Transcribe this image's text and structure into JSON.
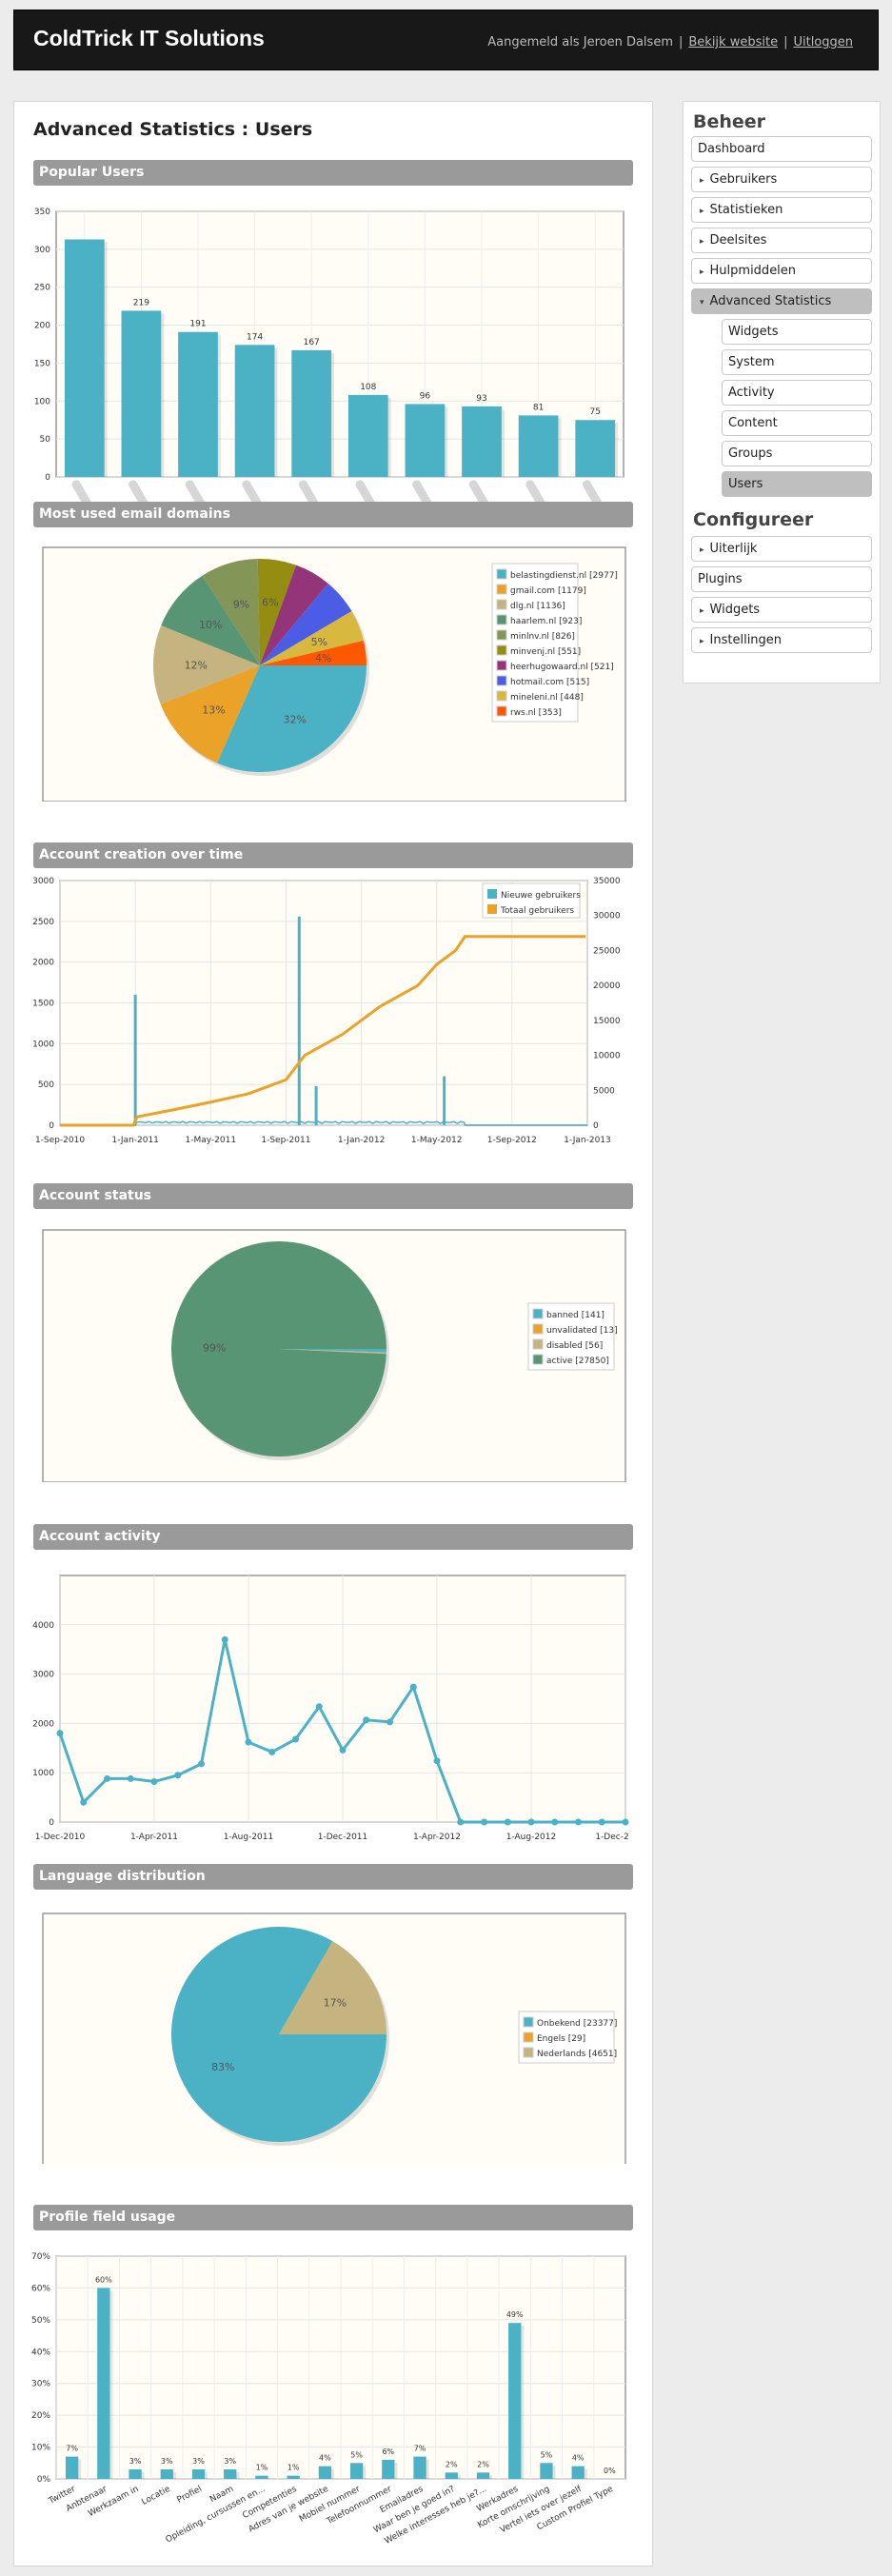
{
  "header": {
    "title": "ColdTrick IT Solutions",
    "logged_in": "Aangemeld als Jeroen Dalsem",
    "sep": "|",
    "view_site": "Bekijk website",
    "logout": "Uitloggen"
  },
  "page": {
    "title": "Advanced Statistics : Users"
  },
  "sections": {
    "popular": "Popular Users",
    "domains": "Most used email domains",
    "creation": "Account creation over time",
    "status": "Account status",
    "activity": "Account activity",
    "language": "Language distribution",
    "profile": "Profile field usage"
  },
  "sidebar": {
    "beheer": "Beheer",
    "configureer": "Configureer",
    "items": [
      {
        "label": "Dashboard",
        "arrow": ""
      },
      {
        "label": "Gebruikers",
        "arrow": "▸"
      },
      {
        "label": "Statistieken",
        "arrow": "▸"
      },
      {
        "label": "Deelsites",
        "arrow": "▸"
      },
      {
        "label": "Hulpmiddelen",
        "arrow": "▸"
      },
      {
        "label": "Advanced Statistics",
        "arrow": "▾"
      }
    ],
    "subitems": [
      "Widgets",
      "System",
      "Activity",
      "Content",
      "Groups",
      "Users"
    ],
    "config_items": [
      {
        "label": "Uiterlijk",
        "arrow": "▸"
      },
      {
        "label": "Plugins",
        "arrow": ""
      },
      {
        "label": "Widgets",
        "arrow": "▸"
      },
      {
        "label": "Instellingen",
        "arrow": "▸"
      }
    ]
  },
  "chart_data": [
    {
      "type": "bar",
      "title": "Popular Users",
      "values": [
        313,
        219,
        191,
        174,
        167,
        108,
        96,
        93,
        81,
        75
      ],
      "labels": [
        "219",
        "191",
        "174",
        "167",
        "108",
        "96",
        "93",
        "81",
        "75"
      ],
      "ylim": [
        0,
        350
      ],
      "yticks": [
        "0",
        "50",
        "100",
        "150",
        "200",
        "250",
        "300",
        "350"
      ],
      "color": "#4bb2c5"
    },
    {
      "type": "pie",
      "title": "Most used email domains",
      "slices": [
        {
          "name": "belastingdienst.nl [2977]",
          "value": 2977,
          "color": "#4bb2c5",
          "label": "32%"
        },
        {
          "name": "gmail.com [1179]",
          "value": 1179,
          "color": "#eaa228",
          "label": "13%"
        },
        {
          "name": "dlg.nl [1136]",
          "value": 1136,
          "color": "#c5b47f",
          "label": "12%"
        },
        {
          "name": "haarlem.nl [923]",
          "value": 923,
          "color": "#579575",
          "label": "10%"
        },
        {
          "name": "minlnv.nl [826]",
          "value": 826,
          "color": "#839557",
          "label": "9%"
        },
        {
          "name": "minvenj.nl [551]",
          "value": 551,
          "color": "#958c12",
          "label": "6%"
        },
        {
          "name": "heerhugowaard.nl [521]",
          "value": 521,
          "color": "#953579",
          "label": ""
        },
        {
          "name": "hotmail.com [515]",
          "value": 515,
          "color": "#4b5de4",
          "label": ""
        },
        {
          "name": "mineleni.nl [448]",
          "value": 448,
          "color": "#d8b83f",
          "label": "5%"
        },
        {
          "name": "rws.nl [353]",
          "value": 353,
          "color": "#ff5800",
          "label": "4%"
        }
      ]
    },
    {
      "type": "line",
      "title": "Account creation over time",
      "x_ticks": [
        "1-Sep-2010",
        "1-Jan-2011",
        "1-May-2011",
        "1-Sep-2011",
        "1-Jan-2012",
        "1-May-2012",
        "1-Sep-2012",
        "1-Jan-2013"
      ],
      "y_ticks": [
        "0",
        "500",
        "1000",
        "1500",
        "2000",
        "2500",
        "3000"
      ],
      "y2_ticks": [
        "0",
        "5000",
        "10000",
        "15000",
        "20000",
        "25000",
        "30000",
        "35000"
      ],
      "series": [
        {
          "name": "Nieuwe gebruikers",
          "color": "#4bb2c5"
        },
        {
          "name": "Totaal gebruikers",
          "color": "#eaa228"
        }
      ],
      "spikes": [
        {
          "month": 4.0,
          "value": 1600
        },
        {
          "month": 12.7,
          "value": 2560
        },
        {
          "month": 13.6,
          "value": 480
        },
        {
          "month": 20.4,
          "value": 600
        }
      ],
      "total": [
        [
          0,
          0
        ],
        [
          3.9,
          0
        ],
        [
          4.1,
          1200
        ],
        [
          6,
          2200
        ],
        [
          8,
          3300
        ],
        [
          10,
          4500
        ],
        [
          12,
          6500
        ],
        [
          13,
          10000
        ],
        [
          15,
          13000
        ],
        [
          17,
          17000
        ],
        [
          19,
          20000
        ],
        [
          20,
          23000
        ],
        [
          21,
          25000
        ],
        [
          21.5,
          27000
        ],
        [
          27.9,
          27000
        ]
      ]
    },
    {
      "type": "pie",
      "title": "Account status",
      "slices": [
        {
          "name": "banned [141]",
          "value": 141,
          "color": "#4bb2c5",
          "label": ""
        },
        {
          "name": "unvalidated [13]",
          "value": 13,
          "color": "#eaa228",
          "label": ""
        },
        {
          "name": "disabled [56]",
          "value": 56,
          "color": "#c5b47f",
          "label": ""
        },
        {
          "name": "active [27850]",
          "value": 27850,
          "color": "#579575",
          "label": "99%"
        }
      ]
    },
    {
      "type": "line",
      "title": "Account activity",
      "x_ticks": [
        "1-Dec-2010",
        "1-Apr-2011",
        "1-Aug-2011",
        "1-Dec-2011",
        "1-Apr-2012",
        "1-Aug-2012",
        "1-Dec-2"
      ],
      "y_ticks": [
        "0",
        "1000",
        "2000",
        "3000",
        "4000"
      ],
      "values": [
        1800,
        400,
        880,
        880,
        820,
        950,
        1180,
        3700,
        1620,
        1420,
        1680,
        2340,
        1460,
        2070,
        2030,
        2740,
        1240,
        0,
        0,
        0,
        0,
        0,
        0,
        0,
        0,
        0,
        0
      ],
      "color": "#4bb2c5"
    },
    {
      "type": "pie",
      "title": "Language distribution",
      "slices": [
        {
          "name": "Onbekend [23377]",
          "value": 23377,
          "color": "#4bb2c5",
          "label": "83%"
        },
        {
          "name": "Engels [29]",
          "value": 29,
          "color": "#eaa228",
          "label": ""
        },
        {
          "name": "Nederlands [4651]",
          "value": 4651,
          "color": "#c5b47f",
          "label": "17%"
        }
      ]
    },
    {
      "type": "bar",
      "title": "Profile field usage",
      "categories": [
        "Twitter",
        "Anbtenaar",
        "Werkzaam in",
        "Locatie",
        "Profiel",
        "Naam",
        "Opleiding, cursussen en...",
        "Competenties",
        "Adres van je website",
        "Mobiel nummer",
        "Telefoonnummer",
        "Emailadres",
        "Waar ben je goed in?",
        "Welke interesses heb je?...",
        "Werkadres",
        "Korte omschrijving",
        "Vertel iets over jezelf",
        "Custom Profiel Type"
      ],
      "values": [
        7,
        60,
        3,
        3,
        3,
        3,
        1,
        1,
        4,
        5,
        6,
        7,
        2,
        2,
        49,
        5,
        4,
        0
      ],
      "labels": [
        "7%",
        "60%",
        "3%",
        "3%",
        "3%",
        "3%",
        "1%",
        "1%",
        "4%",
        "5%",
        "6%",
        "7%",
        "2%",
        "2%",
        "49%",
        "5%",
        "4%",
        "0%"
      ],
      "ylim": [
        0,
        70
      ],
      "yticks": [
        "0%",
        "10%",
        "20%",
        "30%",
        "40%",
        "50%",
        "60%",
        "70%"
      ],
      "color": "#4bb2c5"
    }
  ]
}
